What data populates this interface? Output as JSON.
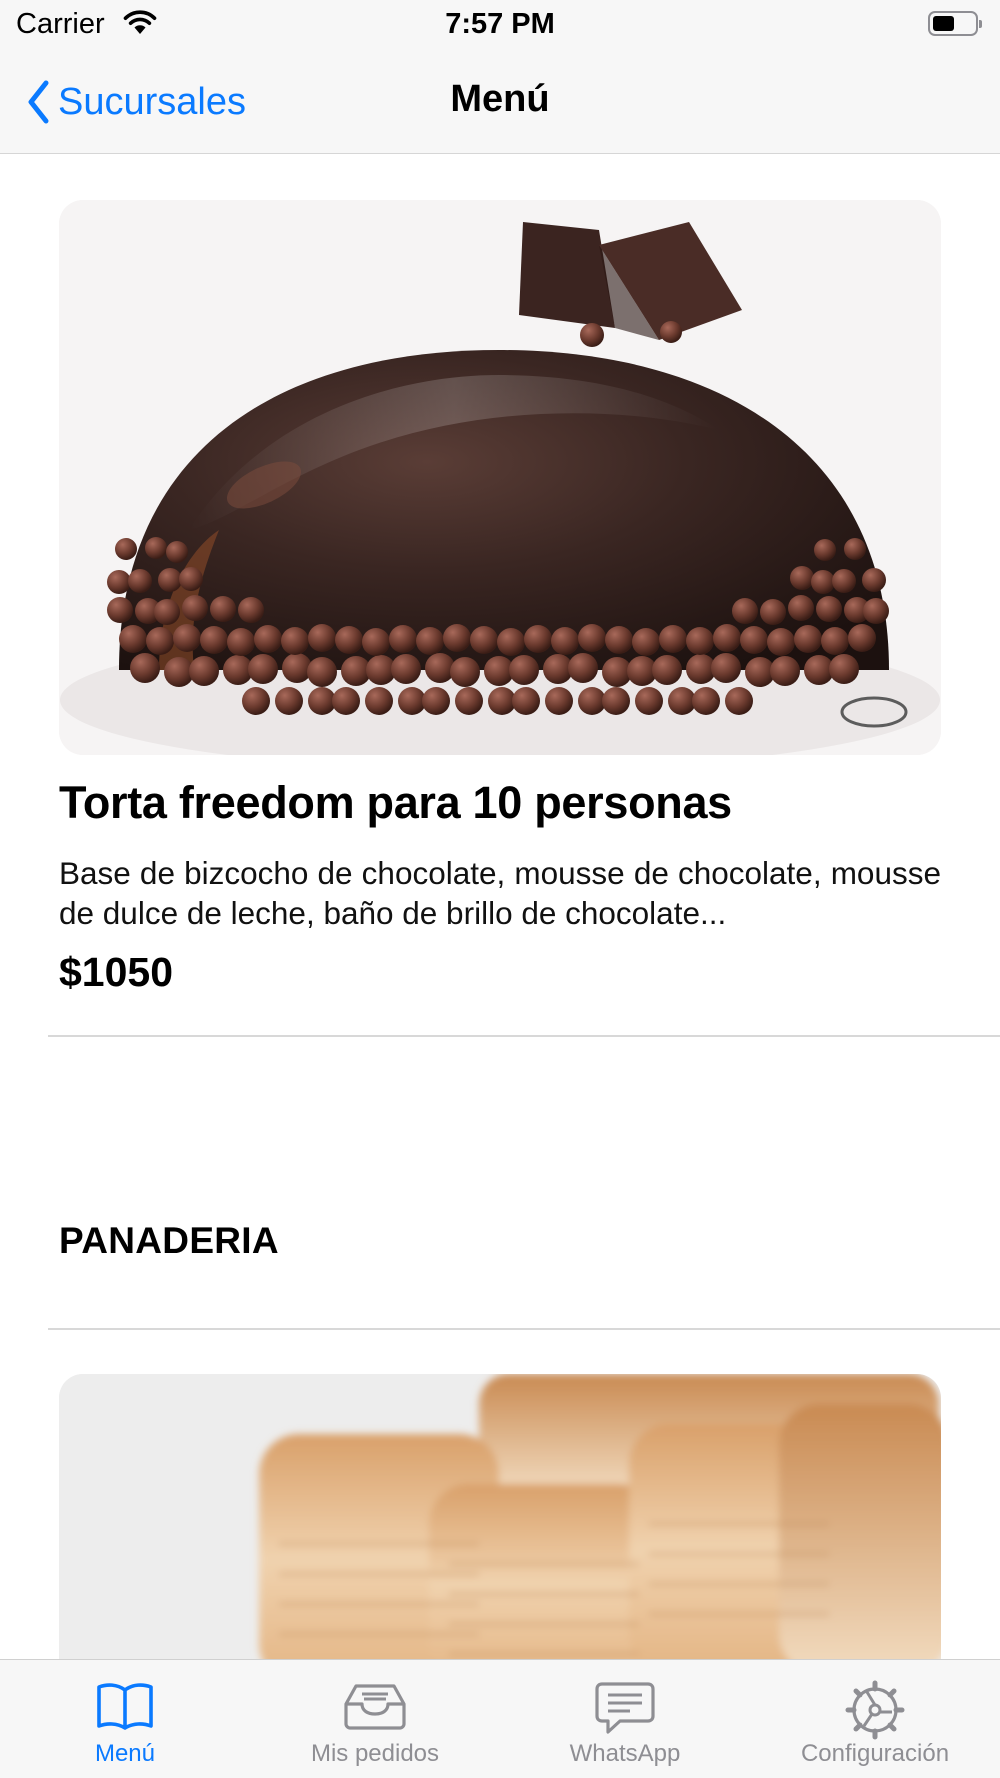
{
  "status_bar": {
    "carrier": "Carrier",
    "time": "7:57 PM",
    "battery_level": 0.5
  },
  "nav": {
    "back_label": "Sucursales",
    "title": "Menú"
  },
  "products": [
    {
      "title": "Torta freedom para 10 personas",
      "description": "Base de bizcocho de chocolate, mousse de chocolate, mousse de dulce de leche, baño de brillo de chocolate...",
      "price": "$1050",
      "image": "chocolate-dome-cake"
    },
    {
      "image": "puff-pastry-bakery"
    }
  ],
  "sections": [
    {
      "title": "PANADERIA"
    }
  ],
  "tab_bar": {
    "tabs": [
      {
        "label": "Menú",
        "icon": "book-icon",
        "active": true
      },
      {
        "label": "Mis pedidos",
        "icon": "tray-icon",
        "active": false
      },
      {
        "label": "WhatsApp",
        "icon": "message-icon",
        "active": false
      },
      {
        "label": "Configuración",
        "icon": "gear-icon",
        "active": false
      }
    ]
  },
  "colors": {
    "accent": "#0a7aff",
    "inactive": "#8e8e93",
    "bar_background": "#f7f7f7"
  }
}
